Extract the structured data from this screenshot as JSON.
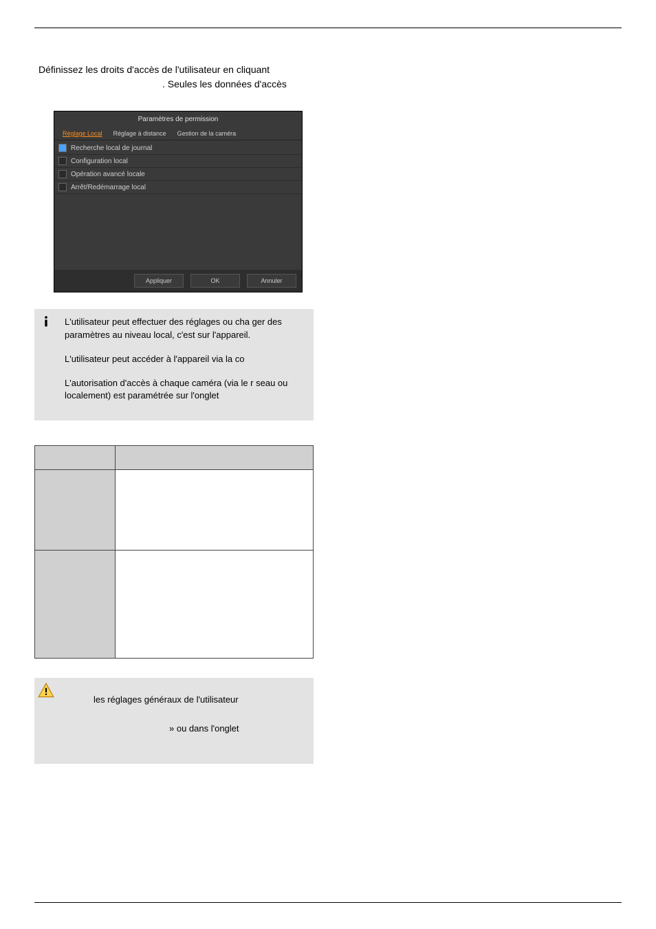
{
  "intro": {
    "line1": "Définissez les droits d'accès de l'utilisateur en cliquant",
    "line2": ". Seules les données d'accès"
  },
  "shot": {
    "title": "Paramètres de permission",
    "tabs": [
      "Réglage Local",
      "Réglage à distance",
      "Gestion de la caméra"
    ],
    "activeTab": 0,
    "rows": [
      {
        "checked": true,
        "label": "Recherche local de journal"
      },
      {
        "checked": false,
        "label": "Configuration local"
      },
      {
        "checked": false,
        "label": "Opération avancé locale"
      },
      {
        "checked": false,
        "label": "Arrêt/Redémarrage local"
      }
    ],
    "buttons": {
      "apply": "Appliquer",
      "ok": "OK",
      "cancel": "Annuler"
    }
  },
  "info": {
    "p1": "L'utilisateur peut effectuer des réglages ou cha ger des paramètres au niveau local, c'est sur l'appareil.",
    "p2": "L'utilisateur peut accéder à l'appareil via la co",
    "p3": "L'autorisation d'accès à chaque caméra (via le r seau ou localement) est paramétrée sur l'onglet"
  },
  "warn": {
    "line1": "les réglages généraux de l'utilisateur",
    "line2": "» ou dans l'onglet"
  }
}
